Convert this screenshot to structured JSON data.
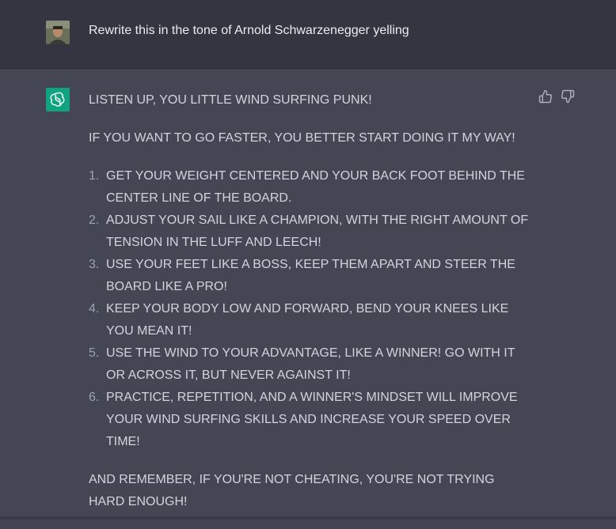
{
  "user_message": {
    "text": "Rewrite this in the tone of Arnold Schwarzenegger yelling"
  },
  "assistant_message": {
    "intro": "LISTEN UP, YOU LITTLE WIND SURFING PUNK!",
    "lead": "IF YOU WANT TO GO FASTER, YOU BETTER START DOING IT MY WAY!",
    "items": [
      {
        "num": "1.",
        "text": "GET YOUR WEIGHT CENTERED AND YOUR BACK FOOT BEHIND THE CENTER LINE OF THE BOARD."
      },
      {
        "num": "2.",
        "text": "ADJUST YOUR SAIL LIKE A CHAMPION, WITH THE RIGHT AMOUNT OF TENSION IN THE LUFF AND LEECH!"
      },
      {
        "num": "3.",
        "text": "USE YOUR FEET LIKE A BOSS, KEEP THEM APART AND STEER THE BOARD LIKE A PRO!"
      },
      {
        "num": "4.",
        "text": "KEEP YOUR BODY LOW AND FORWARD, BEND YOUR KNEES LIKE YOU MEAN IT!"
      },
      {
        "num": "5.",
        "text": "USE THE WIND TO YOUR ADVANTAGE, LIKE A WINNER! GO WITH IT OR ACROSS IT, BUT NEVER AGAINST IT!"
      },
      {
        "num": "6.",
        "text": "PRACTICE, REPETITION, AND A WINNER'S MINDSET WILL IMPROVE YOUR WIND SURFING SKILLS AND INCREASE YOUR SPEED OVER TIME!"
      }
    ],
    "outro": "AND REMEMBER, IF YOU'RE NOT CHEATING, YOU'RE NOT TRYING HARD ENOUGH!"
  },
  "icons": {
    "user_avatar": "user-avatar",
    "assistant_logo": "openai-logo-icon",
    "thumbs_up": "thumbs-up-icon",
    "thumbs_down": "thumbs-down-icon"
  },
  "colors": {
    "user_bg": "#343541",
    "assistant_bg": "#444654",
    "logo_bg": "#10a37f"
  }
}
